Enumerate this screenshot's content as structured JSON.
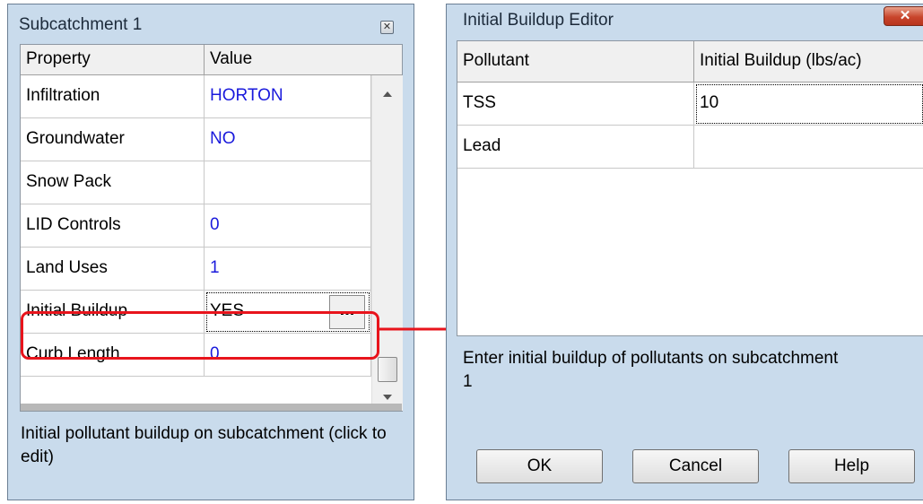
{
  "left_panel": {
    "title": "Subcatchment 1",
    "close_glyph": "✕",
    "columns": [
      "Property",
      "Value"
    ],
    "rows": [
      {
        "property": "Infiltration",
        "value": "HORTON"
      },
      {
        "property": "Groundwater",
        "value": "NO"
      },
      {
        "property": "Snow Pack",
        "value": ""
      },
      {
        "property": "LID Controls",
        "value": "0"
      },
      {
        "property": "Land Uses",
        "value": "1"
      },
      {
        "property": "Initial Buildup",
        "value": "YES"
      },
      {
        "property": "Curb Length",
        "value": "0"
      }
    ],
    "ellipsis_label": "...",
    "description": "Initial pollutant buildup on subcatchment (click to edit)",
    "accent_color": "#e8141c"
  },
  "right_panel": {
    "title": "Initial Buildup Editor",
    "close_glyph": "✕",
    "columns": [
      "Pollutant",
      "Initial Buildup (lbs/ac)"
    ],
    "rows": [
      {
        "pollutant": "TSS",
        "buildup": "10"
      },
      {
        "pollutant": "Lead",
        "buildup": ""
      }
    ],
    "description": "Enter initial buildup of pollutants on subcatchment 1",
    "buttons": {
      "ok": "OK",
      "cancel": "Cancel",
      "help": "Help"
    }
  }
}
